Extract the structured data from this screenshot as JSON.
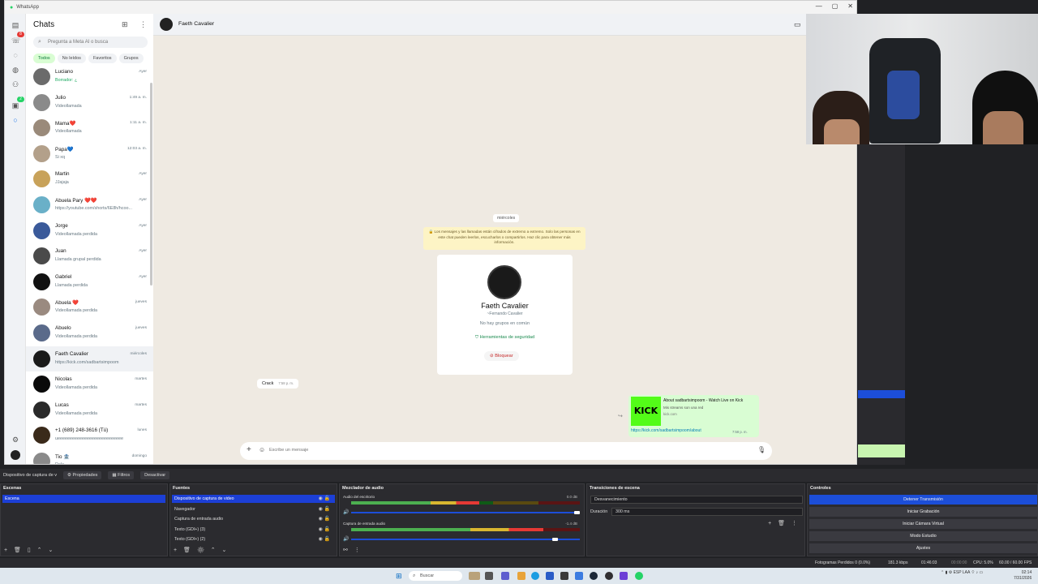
{
  "whatsapp": {
    "window_title": "WhatsApp",
    "rail_badges": {
      "calls": "8",
      "status": "2"
    },
    "list": {
      "title": "Chats",
      "search_placeholder": "Pregunta a Meta AI o busca",
      "filters": [
        "Todos",
        "No leídos",
        "Favoritos",
        "Grupos"
      ],
      "chats": [
        {
          "name": "Luciano",
          "preview": "Borrador: ¿",
          "time": "Ayer",
          "draft": true,
          "color": "#6b6b6b"
        },
        {
          "name": "Julio",
          "preview": "Videollamada",
          "time": "1:49 a. m.",
          "draft": false,
          "color": "#8a8a8a"
        },
        {
          "name": "Mama❤️",
          "preview": "Videollamada",
          "time": "1:11 a. m.",
          "draft": false,
          "color": "#9a8a7a"
        },
        {
          "name": "Papa💙",
          "preview": "Si xq",
          "time": "12:03 a. m.",
          "draft": false,
          "color": "#b3a08a"
        },
        {
          "name": "Martin",
          "preview": "JJajaja",
          "time": "Ayer",
          "draft": false,
          "color": "#c8a25a"
        },
        {
          "name": "Abuela Pary ❤️❤️",
          "preview": "https://youtube.com/shorts/6E8h/hcoo...",
          "time": "Ayer",
          "draft": false,
          "color": "#6ab0c8"
        },
        {
          "name": "Jorge",
          "preview": "Videollamada perdida",
          "time": "Ayer",
          "draft": false,
          "color": "#3a5a9a"
        },
        {
          "name": "Juan",
          "preview": "Llamada grupal perdida",
          "time": "Ayer",
          "draft": false,
          "color": "#4a4a4a"
        },
        {
          "name": "Gabriel",
          "preview": "Llamada perdida",
          "time": "Ayer",
          "draft": false,
          "color": "#111111"
        },
        {
          "name": "Abuela ❤️",
          "preview": "Videollamada perdida",
          "time": "jueves",
          "draft": false,
          "color": "#9a8a80"
        },
        {
          "name": "Abuelo",
          "preview": "Videollamada perdida",
          "time": "jueves",
          "draft": false,
          "color": "#5a6a8a"
        },
        {
          "name": "Faeth Cavalier",
          "preview": "https://kick.com/sadbartsimpoom",
          "time": "miércoles",
          "draft": false,
          "color": "#1a1a1a"
        },
        {
          "name": "Nicolas",
          "preview": "Videollamada perdida",
          "time": "martes",
          "draft": false,
          "color": "#0a0a0a"
        },
        {
          "name": "Lucas",
          "preview": "Videollamada perdida",
          "time": "martes",
          "draft": false,
          "color": "#2a2a2a"
        },
        {
          "name": "+1 (689) 248-3616 (Tú)",
          "preview": "ueeeeeeeeeeeeeeeeeeeeeeeeeee",
          "time": "lunes",
          "draft": false,
          "color": "#3a2a1a"
        },
        {
          "name": "Tio 🏦",
          "preview": "Dale",
          "time": "domingo",
          "draft": false,
          "color": "#8a8a8a"
        }
      ]
    },
    "conversation": {
      "contact_name": "Faeth Cavalier",
      "date_pill": "miércoles",
      "encryption_notice": "🔒 Los mensajes y las llamadas están cifrados de extremo a extremo. Solo las personas en este chat pueden leerlos, escucharlos o compartirlos. Haz clic para obtener más información.",
      "card": {
        "name": "Faeth Cavalier",
        "subtitle": "~Fernando Cavalier",
        "groups": "No hay grupos en común",
        "security": "Herramientas de seguridad",
        "block": "Bloquear"
      },
      "incoming": {
        "text": "Crack",
        "time": "7:58 p. m."
      },
      "outgoing": {
        "thumb": "KICK",
        "title": "About sadbartsimpoom - Watch Live on Kick",
        "description": "Mis streams son una red",
        "domain": "kick.com",
        "link": "https://kick.com/sadbartsimpoom/about",
        "time": "7:58 p. m."
      },
      "compose_placeholder": "Escribe un mensaje"
    }
  },
  "obs": {
    "toolbar": {
      "source_label": "Dispositivo de captura de v",
      "properties": "Propiedades",
      "filters": "Filtros",
      "deactivate": "Desactivar"
    },
    "scenes": {
      "title": "Escenas",
      "items": [
        "Escena"
      ]
    },
    "sources": {
      "title": "Fuentes",
      "items": [
        "Dispositivo de captura de video",
        "Navegador",
        "Captura de entrada audio",
        "Texto (GDI+) (3)",
        "Texto (GDI+) (2)"
      ]
    },
    "mixer": {
      "title": "Mezclador de audio",
      "channels": [
        {
          "name": "Audio del escritorio",
          "db": "0.0 dB",
          "level": 0.56,
          "volume": 1.0
        },
        {
          "name": "Captura de entrada audio",
          "db": "-1.4 dB",
          "level": 0.84,
          "volume": 0.9
        }
      ]
    },
    "transitions": {
      "title": "Transiciones de escena",
      "selected": "Desvanecimiento",
      "duration_label": "Duración",
      "duration_value": "300 ms"
    },
    "controls": {
      "title": "Controles",
      "buttons": [
        "Detener Transmisión",
        "Iniciar Grabación",
        "Iniciar Cámara Virtual",
        "Modo Estudio",
        "Ajustes"
      ]
    },
    "status": {
      "dropped": "Fotogramas Perdidos 0 (0.0%)",
      "bitrate": "181.3 kbps",
      "time": "01:46:03",
      "rec": "00:00:00",
      "cpu": "CPU: 5.0%",
      "fps": "60.00 / 60.00 FPS"
    }
  },
  "taskbar": {
    "search": "Buscar",
    "tray": "ESP LAA",
    "clock_time": "02:14",
    "clock_date": "7/31/2026"
  }
}
